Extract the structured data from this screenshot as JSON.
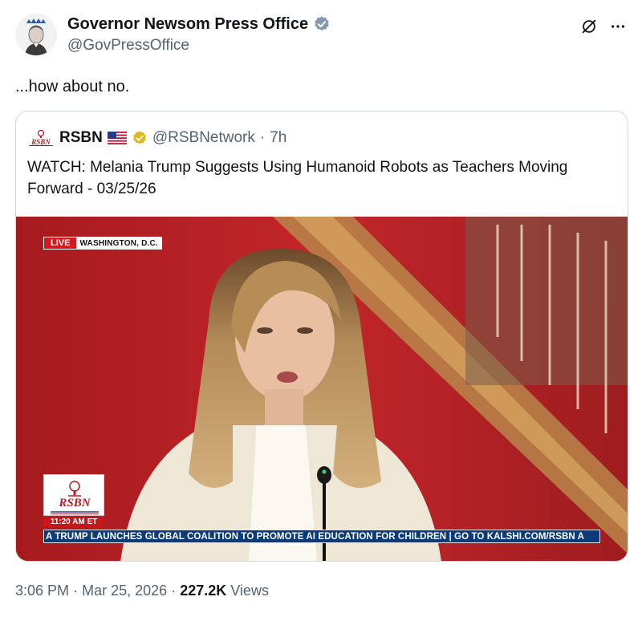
{
  "author": {
    "name": "Governor Newsom Press Office",
    "handle": "@GovPressOffice"
  },
  "icons": {
    "verified": "gray-verified-badge-icon",
    "grok": "grok-icon",
    "more": "more-dots-icon"
  },
  "tweet": {
    "text": "...how about no."
  },
  "quote": {
    "name": "RSBN",
    "handle": "@RSBNetwork",
    "separator": "·",
    "time": "7h",
    "text": "WATCH: Melania Trump Suggests Using Humanoid Robots as Teachers Moving Forward - 03/25/26"
  },
  "video": {
    "live_label": "LIVE",
    "location": "WASHINGTON, D.C.",
    "logo_text": "RSBN",
    "time": "11:20 AM ET",
    "ticker": "A TRUMP LAUNCHES GLOBAL COALITION TO PROMOTE AI EDUCATION FOR CHILDREN  |  GO TO KALSHI.COM/RSBN A"
  },
  "meta": {
    "time": "3:06 PM",
    "separator": "·",
    "date": "Mar 25, 2026",
    "views_count": "227.2K",
    "views_label": "Views"
  },
  "colors": {
    "verified_gray": "#829aab",
    "verified_gold": "#e2b719",
    "secondary_text": "#536471",
    "border": "#cfd9de",
    "live_red": "#d21b1f",
    "ticker_blue": "#0b3b78"
  }
}
